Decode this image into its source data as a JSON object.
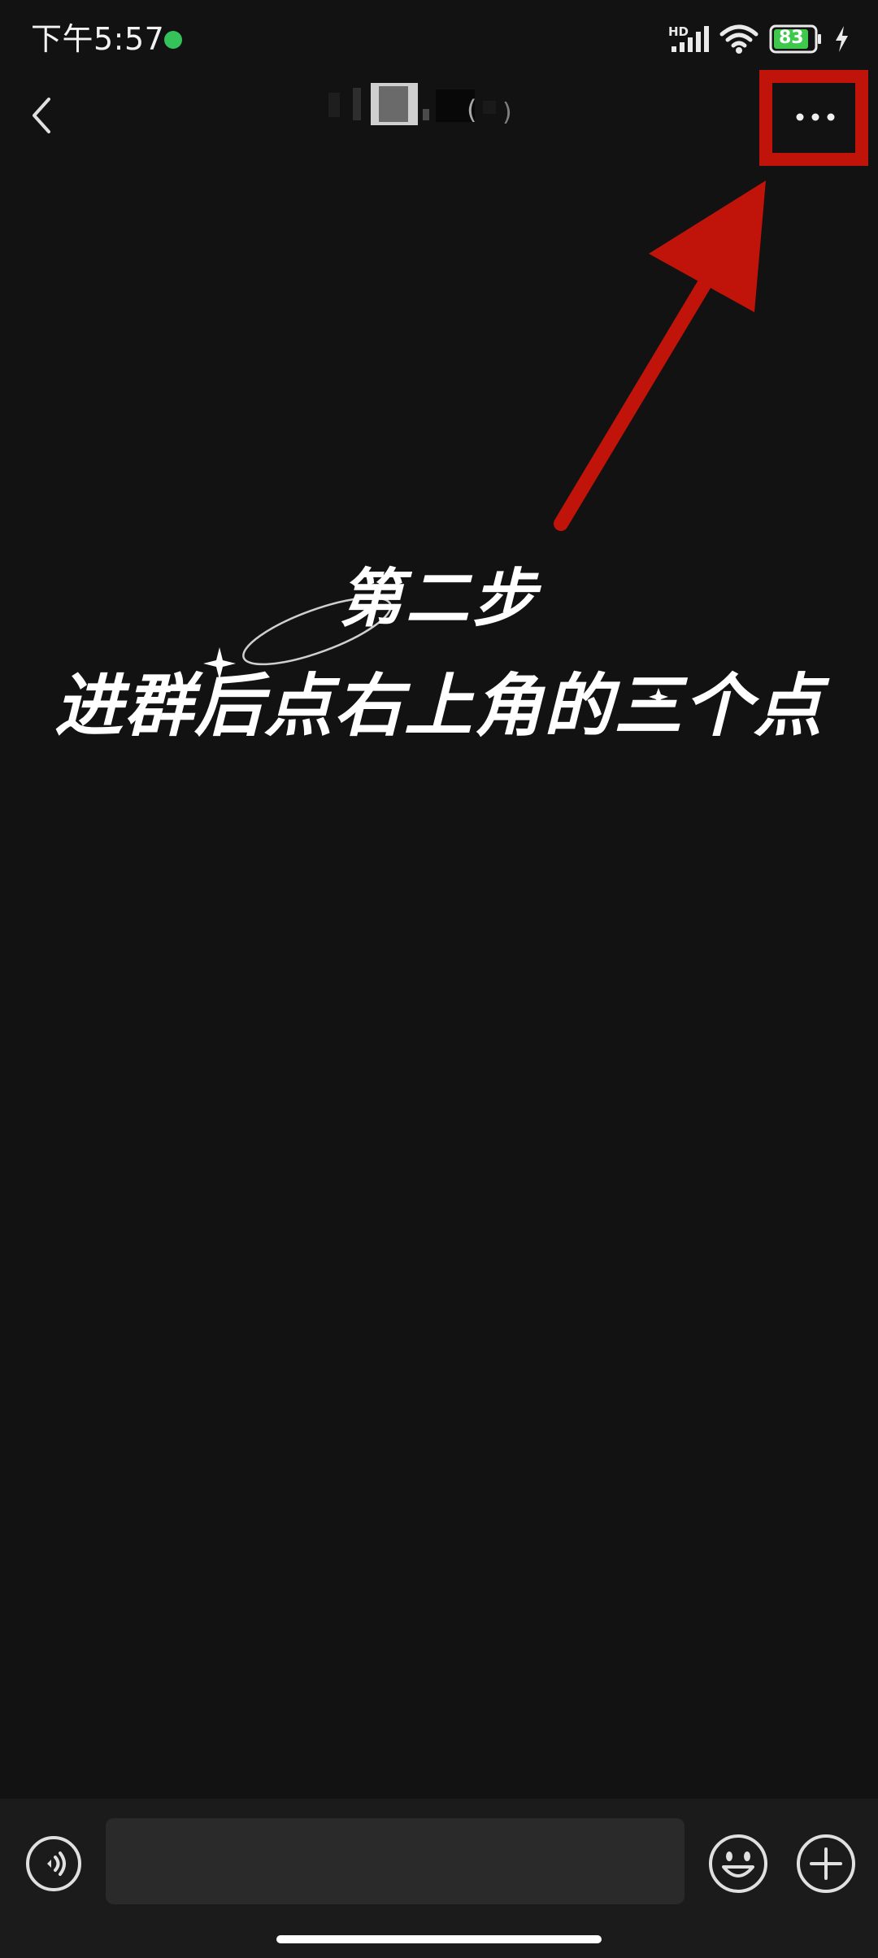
{
  "status_bar": {
    "time": "下午5:57",
    "network_label": "HD",
    "battery_level": "83",
    "icons": [
      "app-notification-icon",
      "signal-icon",
      "wifi-icon",
      "battery-icon",
      "charging-icon"
    ]
  },
  "header": {
    "title": "",
    "back_icon": "chevron-left-icon",
    "more_icon": "ellipsis-icon"
  },
  "tutorial": {
    "step": "第二步",
    "instruction": "进群后点右上角的三个点",
    "highlight_color": "#c0130a"
  },
  "input_bar": {
    "voice_icon": "voice-icon",
    "message_placeholder": "",
    "emoji_icon": "emoji-icon",
    "add_icon": "plus-circle-icon"
  },
  "colors": {
    "background": "#121212",
    "annotation": "#c0130a",
    "input_bar": "#1b1b1b",
    "input_field": "#2a2a2a"
  }
}
